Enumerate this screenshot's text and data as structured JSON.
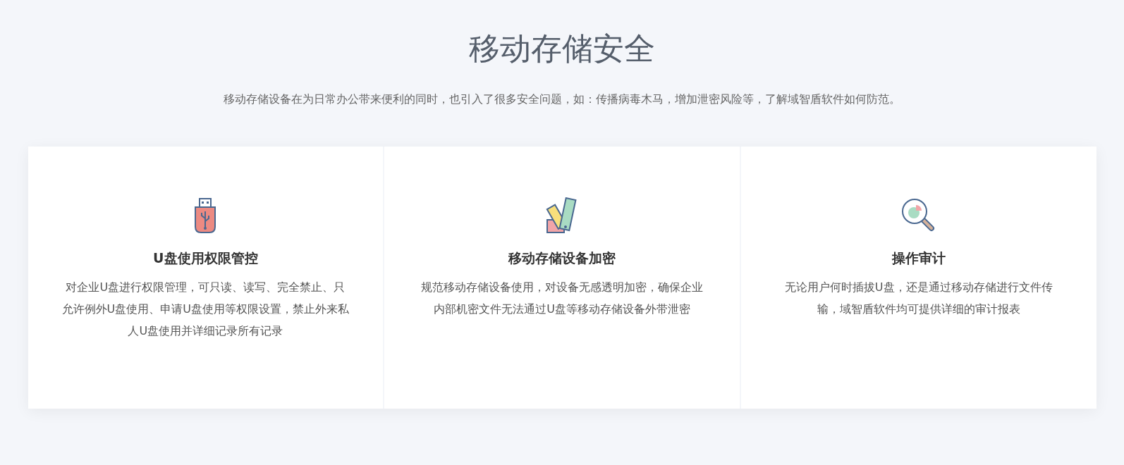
{
  "title": "移动存储安全",
  "subtitle": "移动存储设备在为日常办公带来便利的同时，也引入了很多安全问题，如：传播病毒木马，增加泄密风险等，了解域智盾软件如何防范。",
  "cards": [
    {
      "kind": "usb",
      "title": "U盘使用权限管控",
      "text": "对企业U盘进行权限管理，可只读、读写、完全禁止、只允许例外U盘使用、申请U盘使用等权限设置，禁止外来私人U盘使用并详细记录所有记录"
    },
    {
      "kind": "swatch",
      "title": "移动存储设备加密",
      "text": "规范移动存储设备使用，对设备无感透明加密，确保企业内部机密文件无法通过U盘等移动存储设备外带泄密"
    },
    {
      "kind": "magnifier",
      "title": "操作审计",
      "text": "无论用户何时插拔U盘，还是通过移动存储进行文件传输，域智盾软件均可提供详细的审计报表"
    }
  ]
}
